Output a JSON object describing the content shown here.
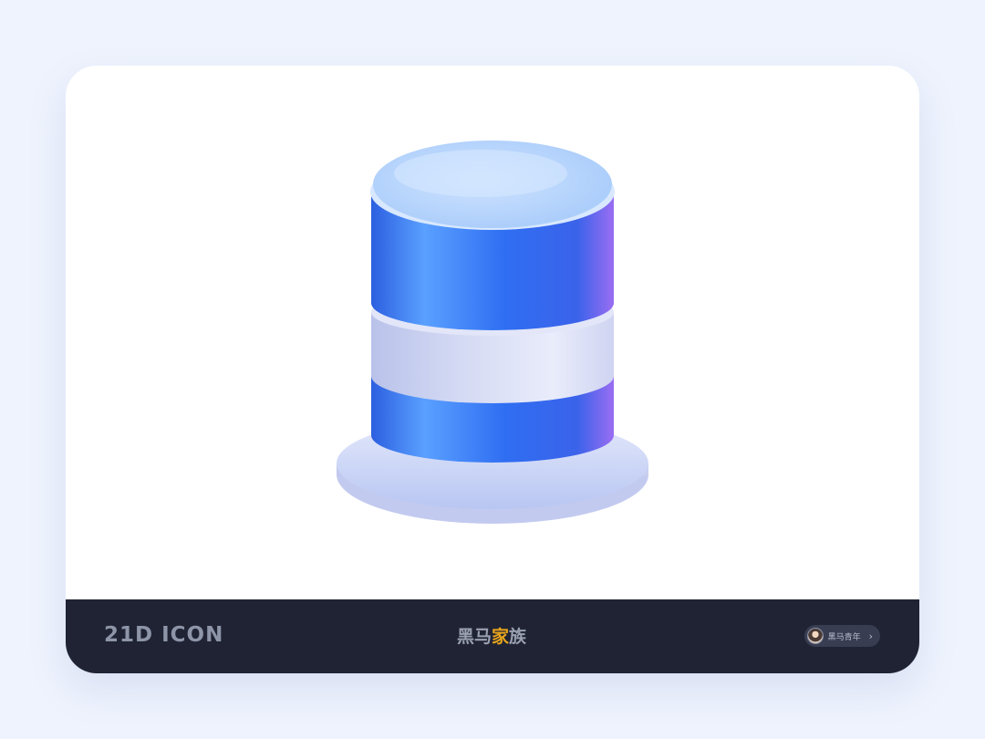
{
  "footer": {
    "brand": "21D ICON",
    "family_logo_main": "黑马",
    "family_logo_accent_char": "家",
    "family_logo_tail": "族",
    "author_name": "黑马青年"
  },
  "illustration": {
    "subject": "database-cylinder-icon",
    "colors": {
      "primary_blue": "#3a74f0",
      "light_blue": "#bcd8fb",
      "violet_edge": "#8f6cf0",
      "silver": "#d6dcf2",
      "base": "#c6d0f2"
    }
  }
}
